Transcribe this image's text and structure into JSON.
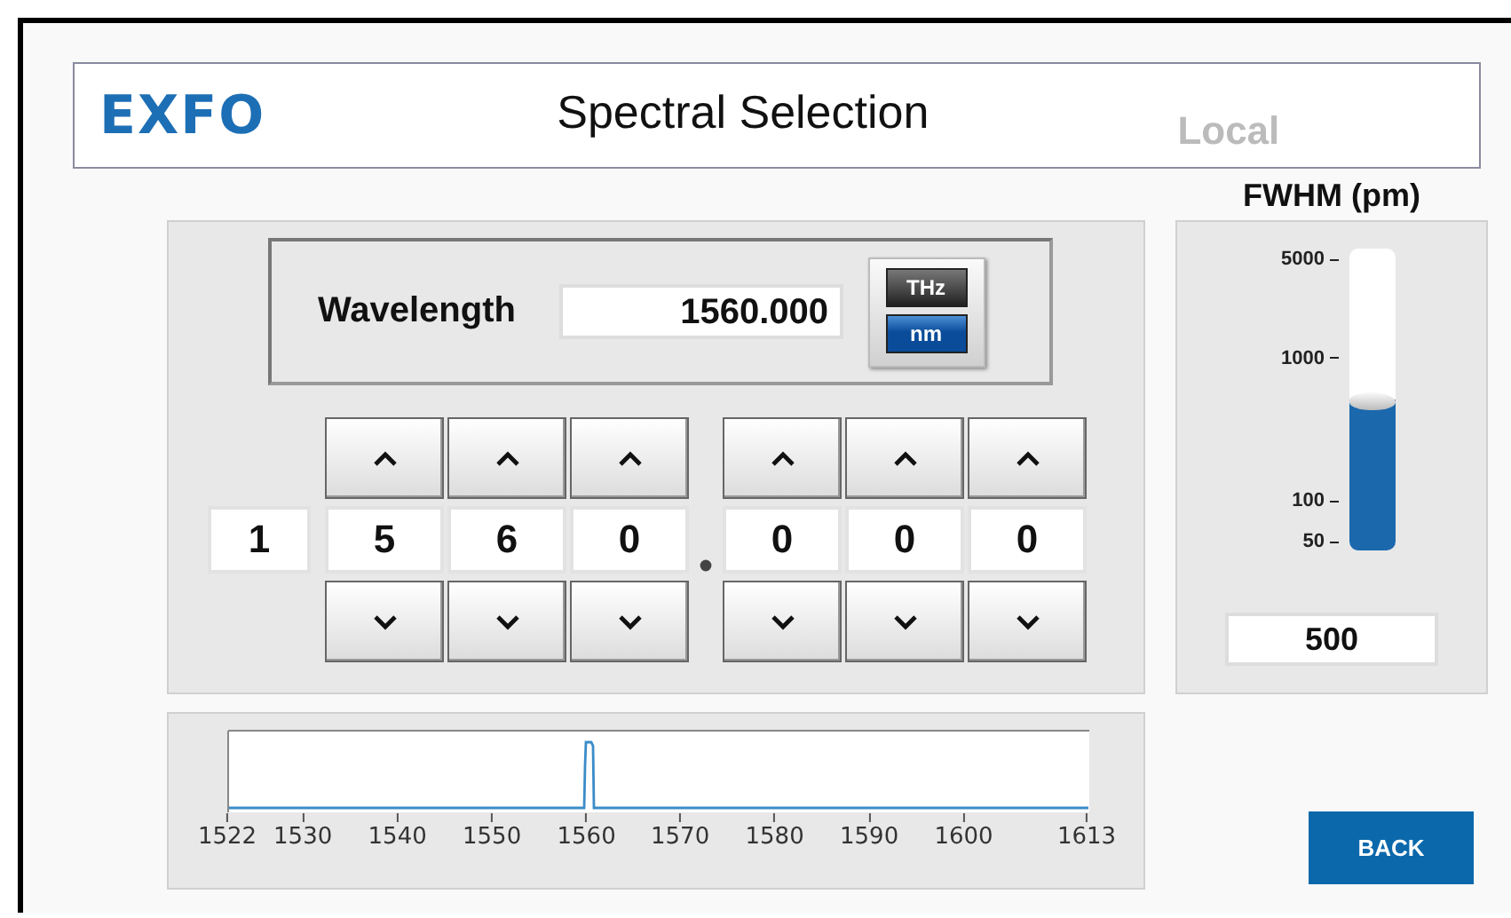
{
  "header": {
    "logo": "EXFO",
    "title": "Spectral Selection",
    "mode": "Local"
  },
  "wavelength": {
    "label": "Wavelength",
    "value": "1560.000",
    "units": [
      {
        "label": "THz",
        "selected": false
      },
      {
        "label": "nm",
        "selected": true
      }
    ]
  },
  "digits": {
    "integer": [
      {
        "value": "1",
        "adjustable": false
      },
      {
        "value": "5",
        "adjustable": true
      },
      {
        "value": "6",
        "adjustable": true
      },
      {
        "value": "0",
        "adjustable": true
      }
    ],
    "fraction": [
      {
        "value": "0",
        "adjustable": true
      },
      {
        "value": "0",
        "adjustable": true
      },
      {
        "value": "0",
        "adjustable": true
      }
    ]
  },
  "fwhm": {
    "label": "FWHM (pm)",
    "ticks": [
      "5000",
      "1000",
      "100",
      "50"
    ],
    "level": 0.5,
    "value": "500"
  },
  "spectrum": {
    "axis_labels": [
      "1522",
      "1530",
      "1540",
      "1550",
      "1560",
      "1570",
      "1580",
      "1590",
      "1600",
      "1613"
    ]
  },
  "buttons": [
    {
      "label": "BACK"
    }
  ]
}
